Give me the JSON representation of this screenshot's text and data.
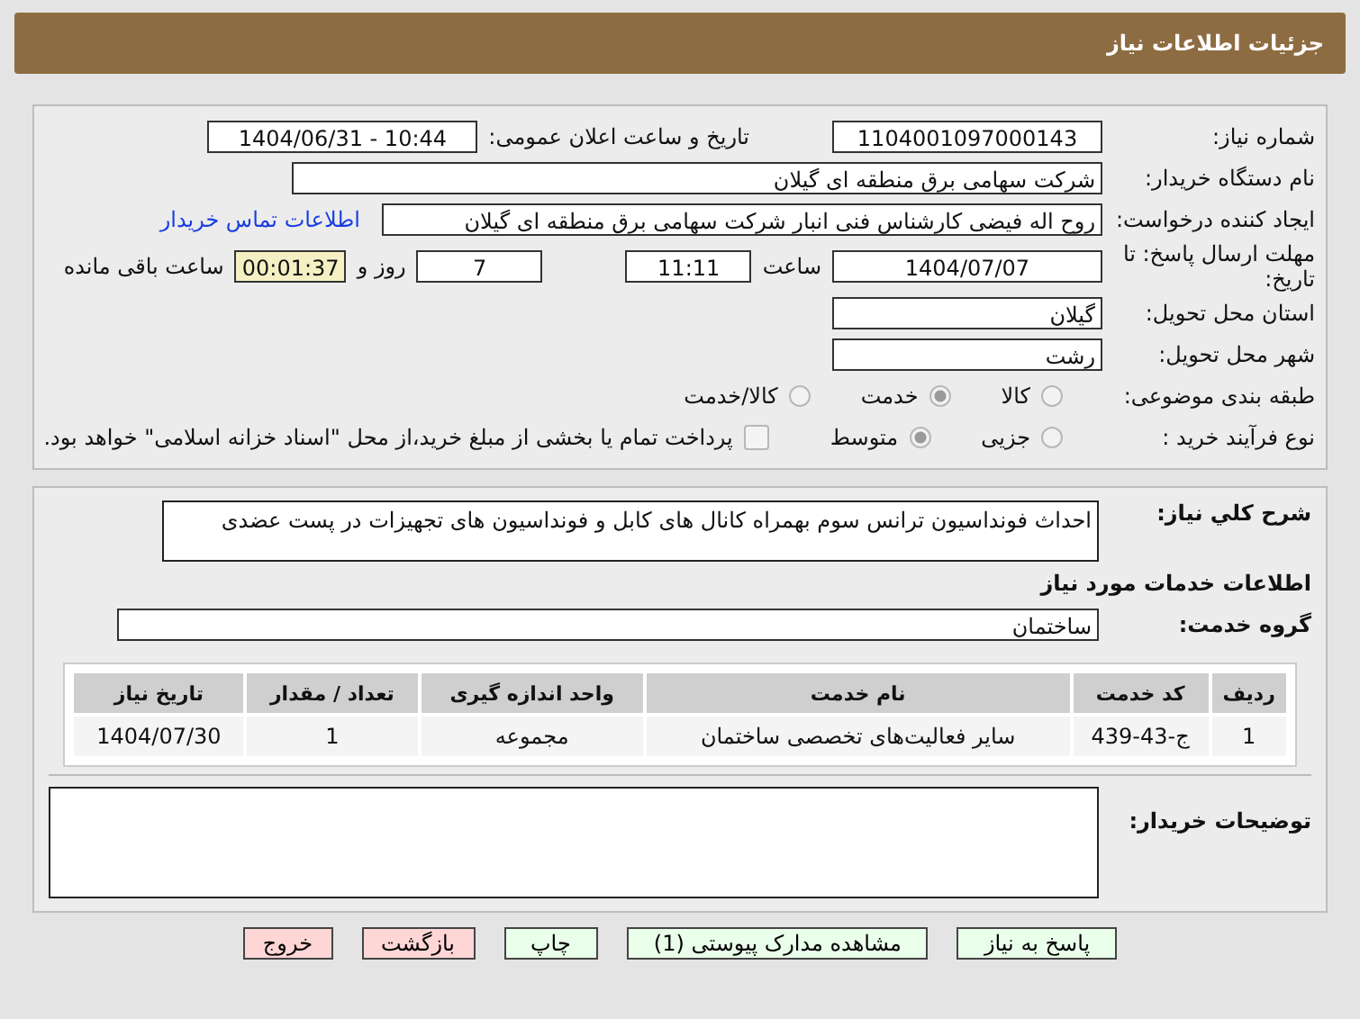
{
  "header": {
    "title": "جزئیات اطلاعات نیاز"
  },
  "info": {
    "need_number_label": "شماره نیاز:",
    "need_number": "1104001097000143",
    "announce_label": "تاریخ و ساعت اعلان عمومی:",
    "announce": "1404/06/31 - 10:44",
    "buyer_org_label": "نام دستگاه خریدار:",
    "buyer_org": "شرکت سهامی برق منطقه ای گیلان",
    "creator_label": "ایجاد کننده درخواست:",
    "creator": "روح اله فیضی کارشناس فنی انبار شرکت سهامی برق منطقه ای گیلان",
    "contact_link": "اطلاعات تماس خریدار",
    "deadline_label": "مهلت ارسال پاسخ: تا تاریخ:",
    "deadline_date": "1404/07/07",
    "time_label": "ساعت",
    "deadline_time": "11:11",
    "days": "7",
    "days_label": "روز و",
    "remaining": "00:01:37",
    "remaining_label": "ساعت باقی مانده",
    "province_label": "استان محل تحویل:",
    "province": "گیلان",
    "city_label": "شهر محل تحویل:",
    "city": "رشت",
    "category_label": "طبقه بندی موضوعی:",
    "category_options": [
      {
        "label": "کالا",
        "selected": false
      },
      {
        "label": "خدمت",
        "selected": true
      },
      {
        "label": "کالا/خدمت",
        "selected": false
      }
    ],
    "process_label": "نوع فرآیند خرید :",
    "process_options": [
      {
        "label": "جزیی",
        "selected": false
      },
      {
        "label": "متوسط",
        "selected": true
      }
    ],
    "payment_checked": false,
    "payment_note": "پرداخت تمام یا بخشی از مبلغ خرید،از محل \"اسناد خزانه اسلامی\" خواهد بود."
  },
  "details": {
    "description_label": "شرح کلي نياز:",
    "description": "احداث فونداسیون ترانس سوم بهمراه کانال های کابل و فونداسیون های تجهیزات در پست عضدی",
    "services_heading": "اطلاعات خدمات مورد نیاز",
    "group_label": "گروه خدمت:",
    "group": "ساختمان",
    "table": {
      "columns": [
        "ردیف",
        "کد خدمت",
        "نام خدمت",
        "واحد اندازه گیری",
        "تعداد / مقدار",
        "تاریخ نیاز"
      ],
      "rows": [
        [
          "1",
          "ج-43-439",
          "سایر فعالیت‌های تخصصی ساختمان",
          "مجموعه",
          "1",
          "1404/07/30"
        ]
      ]
    },
    "notes_label": "توضیحات خریدار:"
  },
  "buttons": [
    {
      "label": "پاسخ به نیاز",
      "kind": "action"
    },
    {
      "label": "مشاهده مدارک پیوستی (1)",
      "kind": "action"
    },
    {
      "label": "چاپ",
      "kind": "action"
    },
    {
      "label": "بازگشت",
      "kind": "exit"
    },
    {
      "label": "خروج",
      "kind": "exit"
    }
  ]
}
